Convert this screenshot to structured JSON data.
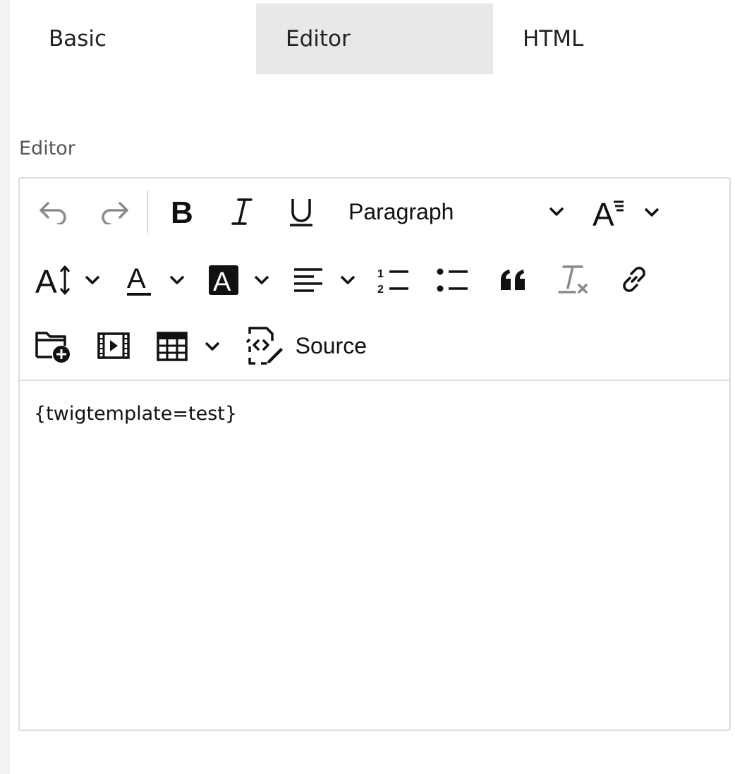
{
  "tabs": [
    {
      "label": "Basic",
      "active": false
    },
    {
      "label": "Editor",
      "active": true
    },
    {
      "label": "HTML",
      "active": false
    }
  ],
  "field": {
    "label": "Editor"
  },
  "toolbar": {
    "heading_select": "Paragraph",
    "source_label": "Source",
    "icons": [
      "undo-icon",
      "redo-icon",
      "bold-icon",
      "italic-icon",
      "underline-icon",
      "font-family-icon",
      "font-size-icon",
      "font-color-icon",
      "font-background-color-icon",
      "align-left-icon",
      "numbered-list-icon",
      "bulleted-list-icon",
      "blockquote-icon",
      "remove-format-icon",
      "link-icon",
      "file-manager-icon",
      "media-embed-icon",
      "insert-table-icon",
      "source-edit-icon"
    ]
  },
  "content": {
    "text": "{twigtemplate=test}"
  },
  "colors": {
    "tab_active_bg": "#e8e8e8",
    "border": "#dcdcdc",
    "disabled_icon": "#8a8a8a"
  }
}
